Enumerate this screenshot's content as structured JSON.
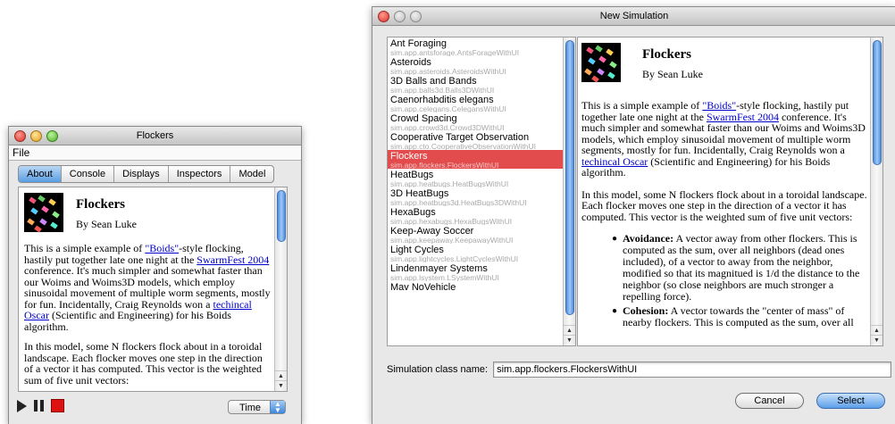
{
  "left_window": {
    "title": "Flockers",
    "menu": [
      "File"
    ],
    "tabs": [
      {
        "label": "About",
        "active": true
      },
      {
        "label": "Console",
        "active": false
      },
      {
        "label": "Displays",
        "active": false
      },
      {
        "label": "Inspectors",
        "active": false
      },
      {
        "label": "Model",
        "active": false
      }
    ],
    "time_select": "Time"
  },
  "about": {
    "title": "Flockers",
    "author": "By Sean Luke",
    "p1_a": "This is a simple example of ",
    "p1_link1": "\"Boids\"",
    "p1_b": "-style flocking, hastily put together late one night at the ",
    "p1_link2": "SwarmFest 2004",
    "p1_c": " conference. It's much simpler and somewhat faster than our Woims and Woims3D models, which employ sinusoidal movement of multiple worm segments, mostly for fun. Incidentally, Craig Reynolds won a ",
    "p1_link3": "techincal Oscar",
    "p1_d": " (Scientific and Engineering) for his Boids algorithm.",
    "p2": "In this model, some N flockers flock about in a toroidal landscape. Each flocker moves one step in the direction of a vector it has computed. This vector is the weighted sum of five unit vectors:",
    "bullet1_term": "Avoidance:",
    "bullet1_text": " A vector away from other flockers. This is computed as the sum, over all neighbors (dead ones included), of a vector to away from the neighbor, modified so that its magnitued is 1/d the distance to the neighbor (so close neighbors are much stronger a repelling force).",
    "bullet2_term": "Cohesion:",
    "bullet2_text": " A vector towards the \"center of mass\" of nearby flockers. This is computed as the sum, over all"
  },
  "right_window": {
    "title": "New Simulation",
    "class_label": "Simulation class name:",
    "class_value": "sim.app.flockers.FlockersWithUI",
    "cancel_label": "Cancel",
    "select_label": "Select"
  },
  "simulations": [
    {
      "name": "Ant Foraging",
      "cls": "sim.app.antsforage.AntsForageWithUI"
    },
    {
      "name": "Asteroids",
      "cls": "sim.app.asteroids.AsteroidsWithUI"
    },
    {
      "name": "3D Balls and Bands",
      "cls": "sim.app.balls3d.Balls3DWithUI"
    },
    {
      "name": "Caenorhabditis elegans",
      "cls": "sim.app.celegans.CelegansWithUI"
    },
    {
      "name": "Crowd Spacing",
      "cls": "sim.app.crowd3d.Crowd3DWithUI"
    },
    {
      "name": "Cooperative Target Observation",
      "cls": "sim.app.cto.CooperativeObservationWithUI"
    },
    {
      "name": "Flockers",
      "cls": "sim.app.flockers.FlockersWithUI",
      "selected": true
    },
    {
      "name": "HeatBugs",
      "cls": "sim.app.heatbugs.HeatBugsWithUI"
    },
    {
      "name": "3D HeatBugs",
      "cls": "sim.app.heatbugs3d.HeatBugs3DWithUI"
    },
    {
      "name": "HexaBugs",
      "cls": "sim.app.hexabugs.HexaBugsWithUI"
    },
    {
      "name": "Keep-Away Soccer",
      "cls": "sim.app.keepaway.KeepawayWithUI"
    },
    {
      "name": "Light Cycles",
      "cls": "sim.app.lightcycles.LightCyclesWithUI"
    },
    {
      "name": "Lindenmayer Systems",
      "cls": "sim.app.lsystem.LSystemWithUI"
    },
    {
      "name": "Mav NoVehicle",
      "cls": ""
    }
  ],
  "colors": {
    "selection": "#e24c4c",
    "link": "#0000cc",
    "stop_button": "#dd1111"
  }
}
